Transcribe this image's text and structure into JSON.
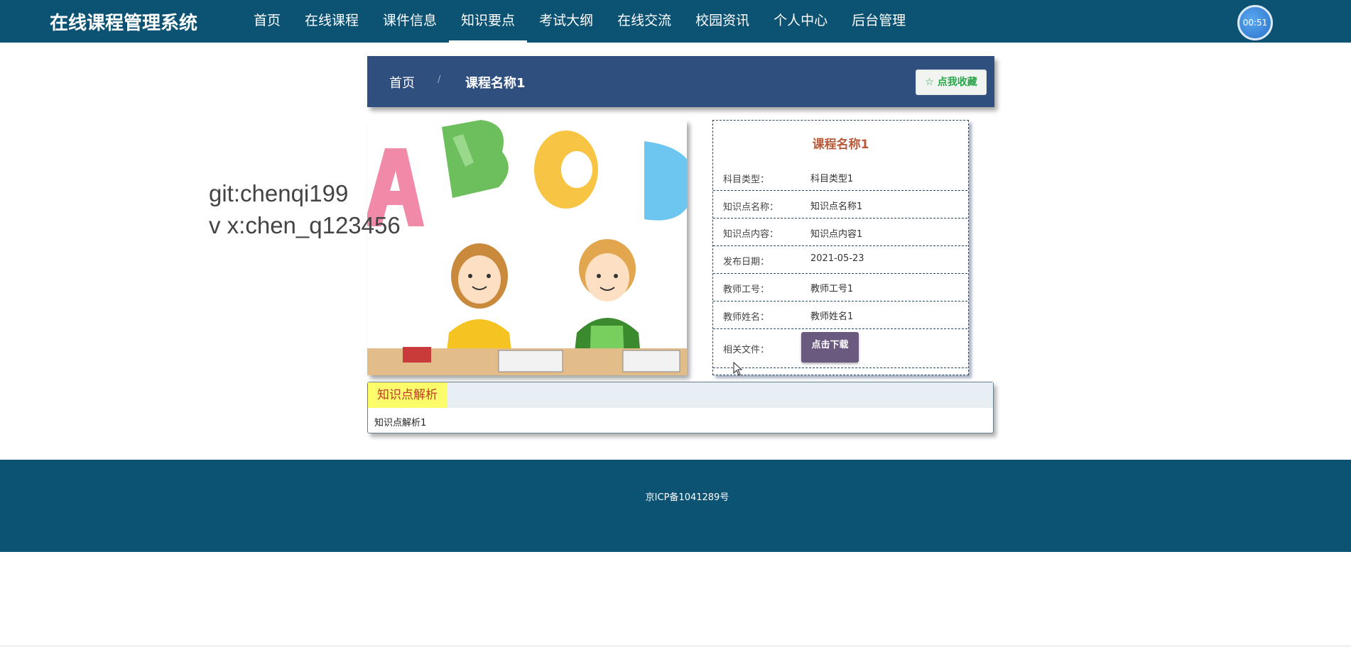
{
  "header": {
    "brand": "在线课程管理系统",
    "nav": [
      {
        "label": "首页"
      },
      {
        "label": "在线课程"
      },
      {
        "label": "课件信息"
      },
      {
        "label": "知识要点",
        "active": true
      },
      {
        "label": "考试大纲"
      },
      {
        "label": "在线交流"
      },
      {
        "label": "校园资讯"
      },
      {
        "label": "个人中心"
      },
      {
        "label": "后台管理"
      }
    ],
    "timer": "00:51"
  },
  "breadcrumb": {
    "home": "首页",
    "separator": "/",
    "current": "课程名称1",
    "favorite_label": "☆ 点我收藏"
  },
  "watermark": {
    "line1": "git:chenqi199",
    "line2": "v x:chen_q123456"
  },
  "details": {
    "title": "课程名称1",
    "rows": [
      {
        "label": "科目类型：",
        "value": "科目类型1"
      },
      {
        "label": "知识点名称：",
        "value": "知识点名称1"
      },
      {
        "label": "知识点内容：",
        "value": "知识点内容1"
      },
      {
        "label": "发布日期：",
        "value": "2021-05-23"
      },
      {
        "label": "教师工号：",
        "value": "教师工号1"
      },
      {
        "label": "教师姓名：",
        "value": "教师姓名1"
      },
      {
        "label": "相关文件：",
        "value": ""
      }
    ],
    "download_label": "点击下载"
  },
  "analysis": {
    "tab": "知识点解析",
    "body": "知识点解析1"
  },
  "footer": {
    "icp": "京ICP备1041289号"
  },
  "colors": {
    "nav_bg": "#0b5273",
    "crumb_bg": "#2f4f7f",
    "title_accent": "#b85a3a",
    "download_bg": "#6b5a80",
    "tab_bg": "#fdfc6a"
  }
}
